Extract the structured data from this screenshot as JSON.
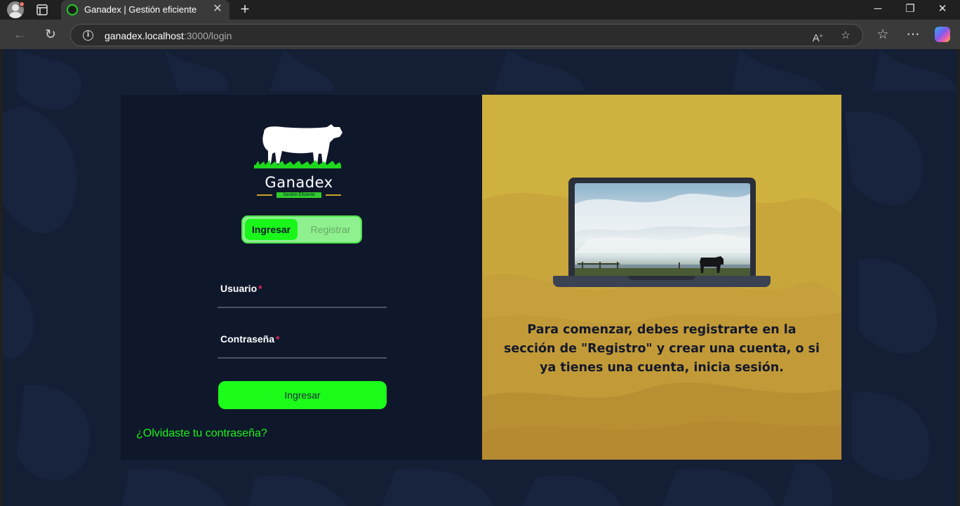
{
  "browser": {
    "tab_title": "Ganadex | Gestión eficiente",
    "url_host": "ganadex.localhost",
    "url_rest": ":3000/login",
    "icons": [
      "profile-icon",
      "tab-actions-icon",
      "close-icon",
      "new-tab-icon",
      "minimize-icon",
      "restore-icon",
      "close-window-icon",
      "back-icon",
      "refresh-icon",
      "info-icon",
      "read-aloud-icon",
      "favorite-icon",
      "favorites-icon",
      "more-icon",
      "copilot-icon"
    ]
  },
  "brand": {
    "name": "Ganadex",
    "tagline": "Gestión Eficiente"
  },
  "auth_toggle": {
    "active_label": "Ingresar",
    "inactive_label": "Registrar"
  },
  "form": {
    "username_label": "Usuario",
    "password_label": "Contraseña",
    "required_mark": "*",
    "submit_label": "Ingresar",
    "forgot_link": "¿Olvidaste tu contraseña?"
  },
  "panel": {
    "message": "Para comenzar, debes registrarte en la sección de \"Registro\" y crear una cuenta, o si ya tienes una cuenta, inicia sesión."
  },
  "colors": {
    "accent_green": "#1af61a",
    "page_background": "#141f36",
    "card_background": "#0f172b",
    "panel_gold": "#c9a63c",
    "required_red": "#e0245e"
  }
}
